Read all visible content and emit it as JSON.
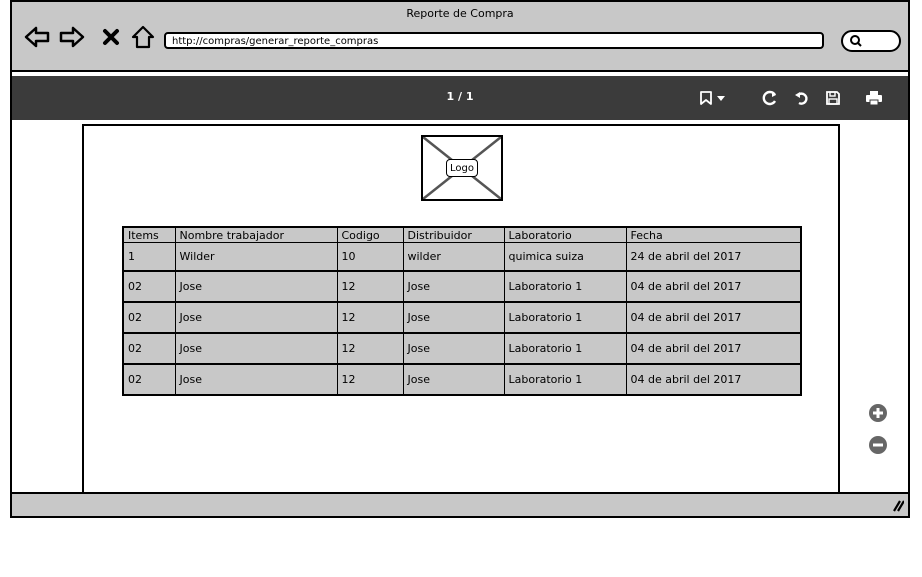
{
  "window": {
    "title": "Reporte de Compra"
  },
  "browser": {
    "icons": [
      "back-arrow-icon",
      "forward-arrow-icon",
      "stop-icon",
      "home-icon",
      "search-icon"
    ],
    "url": "http://compras/generar_reporte_compras"
  },
  "viewer": {
    "page_indicator": "1 / 1",
    "toolbar_icons": [
      "bookmark-icon",
      "rotate-icon",
      "undo-icon",
      "save-icon",
      "print-icon"
    ]
  },
  "document": {
    "logo_label": "Logo",
    "table": {
      "columns": [
        "Items",
        "Nombre trabajador",
        "Codigo",
        "Distribuidor",
        "Laboratorio",
        "Fecha"
      ],
      "rows": [
        [
          "1",
          "Wilder",
          "10",
          "wilder",
          "quimica suiza",
          "24 de abril del 2017"
        ],
        [
          "02",
          "Jose",
          "12",
          "Jose",
          "Laboratorio 1",
          "04 de abril del 2017"
        ],
        [
          "02",
          "Jose",
          "12",
          "Jose",
          "Laboratorio 1",
          "04 de abril del 2017"
        ],
        [
          "02",
          "Jose",
          "12",
          "Jose",
          "Laboratorio 1",
          "04 de abril del 2017"
        ],
        [
          "02",
          "Jose",
          "12",
          "Jose",
          "Laboratorio 1",
          "04 de abril del 2017"
        ]
      ]
    }
  },
  "zoom": {
    "icons": [
      "zoom-in-icon",
      "zoom-out-icon"
    ]
  },
  "colors": {
    "chrome": "#c8c8c8",
    "toolbar": "#3b3b3b",
    "table_fill": "#c8c8c8"
  }
}
